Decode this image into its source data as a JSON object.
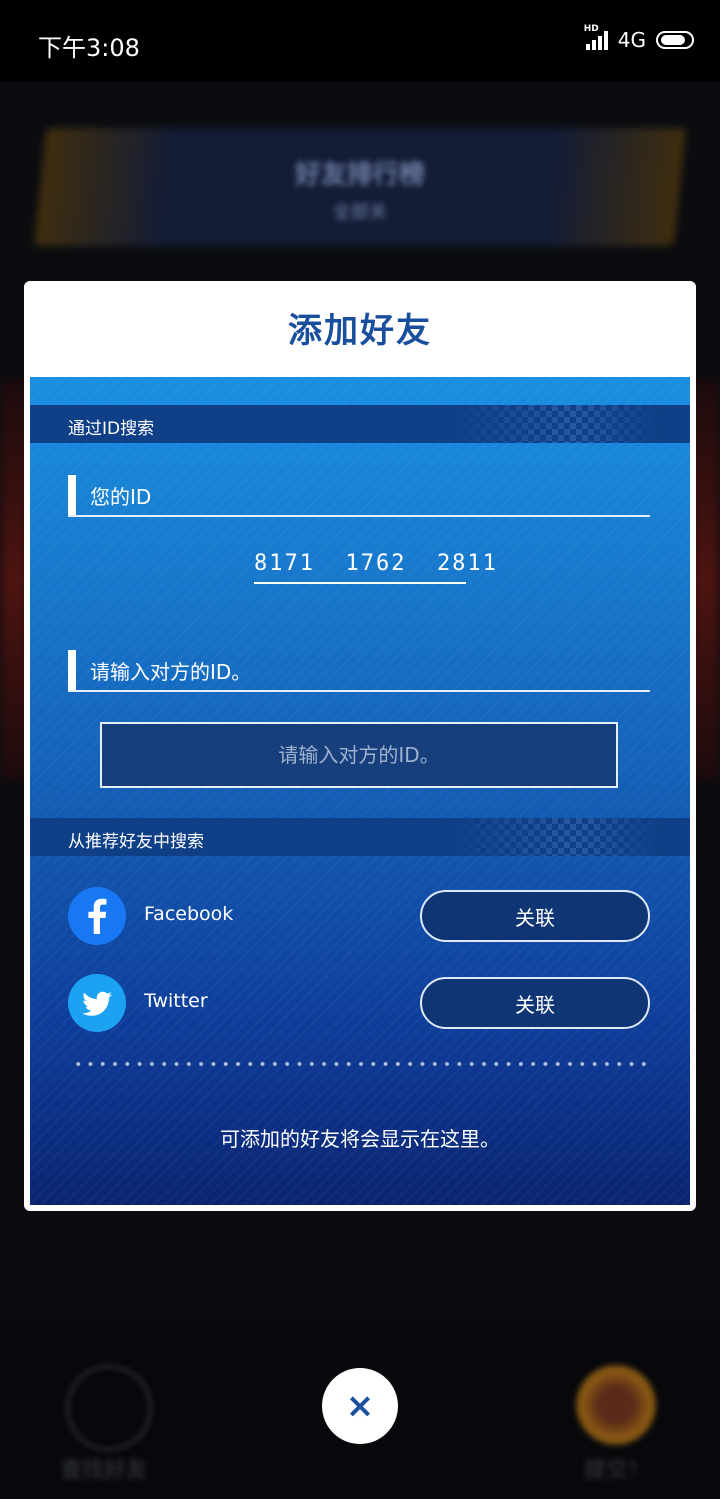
{
  "status_bar": {
    "time": "下午3:08",
    "network": "4G",
    "hd_label": "HD"
  },
  "background": {
    "banner_title": "好友排行榜",
    "banner_subtitle": "全部关",
    "bottom_left_label": "查找好友",
    "bottom_right_label": "提交！"
  },
  "dialog": {
    "title": "添加好友",
    "search_by_id": {
      "header": "通过ID搜索",
      "your_id_label": "您的ID",
      "your_id_value": "8171  1762  2811",
      "enter_id_label": "请输入对方的ID。",
      "enter_id_placeholder": "请输入对方的ID。",
      "enter_id_value": ""
    },
    "recommended": {
      "header": "从推荐好友中搜索",
      "items": [
        {
          "name": "Facebook",
          "icon": "facebook-icon",
          "button_label": "关联",
          "color": "#1877f2"
        },
        {
          "name": "Twitter",
          "icon": "twitter-icon",
          "button_label": "关联",
          "color": "#1da1f2"
        }
      ]
    },
    "empty_message": "可添加的好友将会显示在这里。"
  },
  "close_button": {
    "icon": "close-icon",
    "label": "×"
  },
  "colors": {
    "accent": "#1a4f9e",
    "panel_top": "#1a8fe0",
    "panel_bottom": "#0a2470"
  }
}
